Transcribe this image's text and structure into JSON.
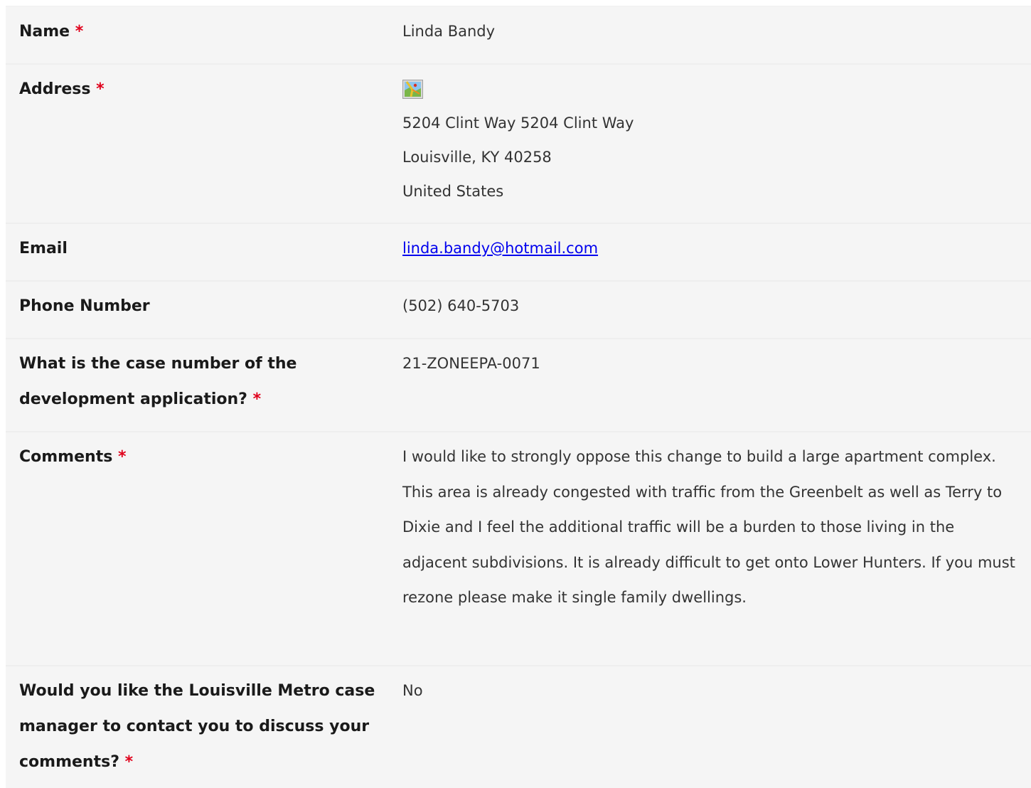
{
  "fields": {
    "name": {
      "label": "Name",
      "required_mark": "*",
      "value": "Linda Bandy"
    },
    "address": {
      "label": "Address",
      "required_mark": "*",
      "icon": "map-icon",
      "line1": "5204 Clint Way 5204 Clint Way",
      "line2": "Louisville, KY 40258",
      "line3": "United States"
    },
    "email": {
      "label": "Email",
      "value": "linda.bandy@hotmail.com"
    },
    "phone": {
      "label": "Phone Number",
      "value": "(502) 640-5703"
    },
    "case_number": {
      "label": "What is the case number of the development application?",
      "required_mark": "*",
      "value": "21-ZONEEPA-0071"
    },
    "comments": {
      "label": "Comments",
      "required_mark": "*",
      "value": "I would like to strongly oppose this change to build a large apartment complex. This area is already congested with traffic from the Greenbelt as well as Terry to Dixie and I feel the additional traffic will be a burden to those living in the adjacent subdivisions. It is already difficult to get onto Lower Hunters. If you must rezone please make it single family dwellings."
    },
    "contact": {
      "label": "Would you like the Louisville Metro case manager to contact you to discuss your comments?",
      "required_mark": "*",
      "value": "No"
    }
  },
  "colors": {
    "required": "#e0001b",
    "link": "#0000ee",
    "row_background": "#f5f5f5"
  }
}
